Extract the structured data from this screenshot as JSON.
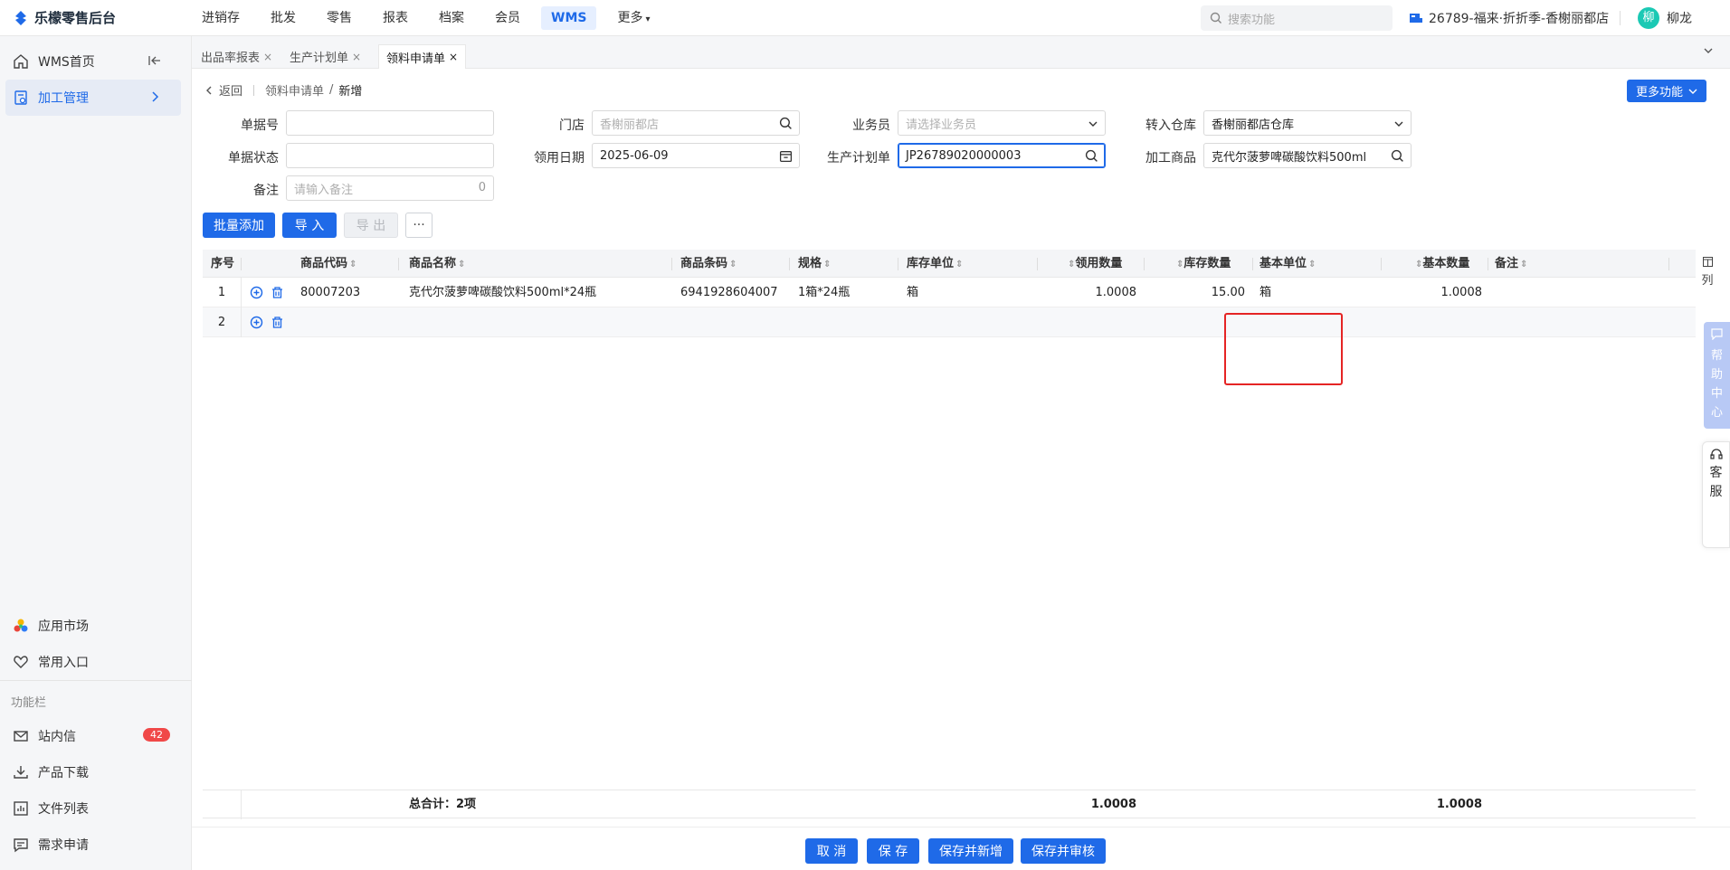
{
  "app": {
    "title": "乐檬零售后台"
  },
  "topnav": {
    "items": [
      "进销存",
      "批发",
      "零售",
      "报表",
      "档案",
      "会员",
      "WMS",
      "更多"
    ],
    "search_placeholder": "搜索功能",
    "store": "26789-福来·折折季-香榭丽都店",
    "user_initial": "柳",
    "user_name": "柳龙"
  },
  "sidebar": {
    "home": "WMS首页",
    "processing": "加工管理",
    "app_market": "应用市场",
    "common_entry": "常用入口",
    "section_title": "功能栏",
    "inbox": "站内信",
    "inbox_badge": "42",
    "download": "产品下载",
    "file_list": "文件列表",
    "request": "需求申请"
  },
  "tabs": [
    "出品率报表",
    "生产计划单",
    "领料申请单"
  ],
  "breadcrumb": {
    "back": "返回",
    "parent": "领料申请单",
    "current": "新增"
  },
  "more_functions": "更多功能",
  "form": {
    "doc_no": {
      "label": "单据号",
      "value": ""
    },
    "store": {
      "label": "门店",
      "placeholder": "香榭丽都店"
    },
    "salesman": {
      "label": "业务员",
      "placeholder": "请选择业务员"
    },
    "to_warehouse": {
      "label": "转入仓库",
      "value": "香榭丽都店仓库"
    },
    "doc_status": {
      "label": "单据状态",
      "value": ""
    },
    "use_date": {
      "label": "领用日期",
      "value": "2025-06-09"
    },
    "plan_no": {
      "label": "生产计划单",
      "value": "JP26789020000003"
    },
    "process_item": {
      "label": "加工商品",
      "value": "克代尔菠萝啤碳酸饮料500ml"
    },
    "remark": {
      "label": "备注",
      "placeholder": "请输入备注",
      "count": "0"
    }
  },
  "toolbar": {
    "batch_add": "批量添加",
    "import": "导 入",
    "export": "导 出",
    "more": "···"
  },
  "table": {
    "headers": {
      "seq": "序号",
      "code": "商品代码",
      "name": "商品名称",
      "barcode": "商品条码",
      "spec": "规格",
      "stock_unit": "库存单位",
      "use_qty": "领用数量",
      "stock_qty": "库存数量",
      "base_unit": "基本单位",
      "base_qty": "基本数量",
      "remark": "备注"
    },
    "rows": [
      {
        "seq": "1",
        "code": "80007203",
        "name": "克代尔菠萝啤碳酸饮料500ml*24瓶",
        "barcode": "6941928604007",
        "spec": "1箱*24瓶",
        "stock_unit": "箱",
        "use_qty": "1.0008",
        "stock_qty": "15.00",
        "base_unit": "箱",
        "base_qty": "1.0008"
      },
      {
        "seq": "2"
      }
    ],
    "footer": {
      "total_label": "总合计：2项",
      "use_qty_total": "1.0008",
      "base_qty_total": "1.0008"
    },
    "col_toggle": "列"
  },
  "side_float": {
    "help": [
      "帮",
      "助",
      "中",
      "心"
    ],
    "service": [
      "客",
      "服"
    ]
  },
  "actions": {
    "cancel": "取 消",
    "save": "保 存",
    "save_new": "保存并新增",
    "save_audit": "保存并审核"
  },
  "colors": {
    "primary": "#1f6ae8",
    "highlight": "#e52424"
  }
}
